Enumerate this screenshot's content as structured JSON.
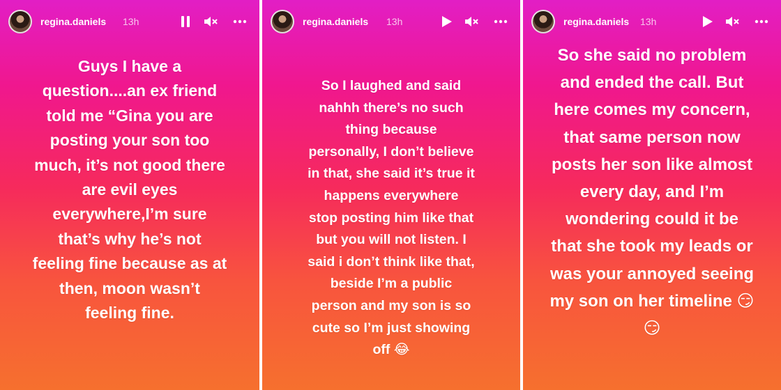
{
  "stories": [
    {
      "username": "regina.daniels",
      "time": "13h",
      "playback_state": "pause-icon",
      "volume_state": "mute-icon",
      "more_icon": "more-icon",
      "text": "Guys I have a\nquestion....an ex friend\ntold me “Gina you are\nposting your son too\nmuch, it’s not good there\nare evil eyes\neverywhere,I’m sure\nthat’s why he’s not\nfeeling fine because as at\nthen, moon wasn’t\nfeeling fine."
    },
    {
      "username": "regina.daniels",
      "time": "13h",
      "playback_state": "play-icon",
      "volume_state": "mute-icon",
      "more_icon": "more-icon",
      "text": "So I laughed and said\nnahhh there’s no such\nthing because\npersonally, I don’t believe\nin that, she said it’s true it\nhappens everywhere\nstop posting him like that\nbut you will not listen. I\nsaid i don’t think like that,\nbeside I’m a public\nperson and my son is so\ncute so I’m just showing\noff 😂"
    },
    {
      "username": "regina.daniels",
      "time": "13h",
      "playback_state": "play-icon",
      "volume_state": "mute-icon",
      "more_icon": "more-icon",
      "text": "So she said no problem\nand ended the call. But\nhere comes my concern,\nthat same person now\nposts her son like almost\nevery day, and I’m\nwondering could it be\nthat she took my leads or\nwas your annoyed seeing\nmy son on her timeline 😏\n😏"
    }
  ],
  "colors": {
    "gradient_top": "#e21ec5",
    "gradient_mid": "#f62a5c",
    "gradient_bottom": "#f6702e",
    "text": "#ffffff"
  }
}
